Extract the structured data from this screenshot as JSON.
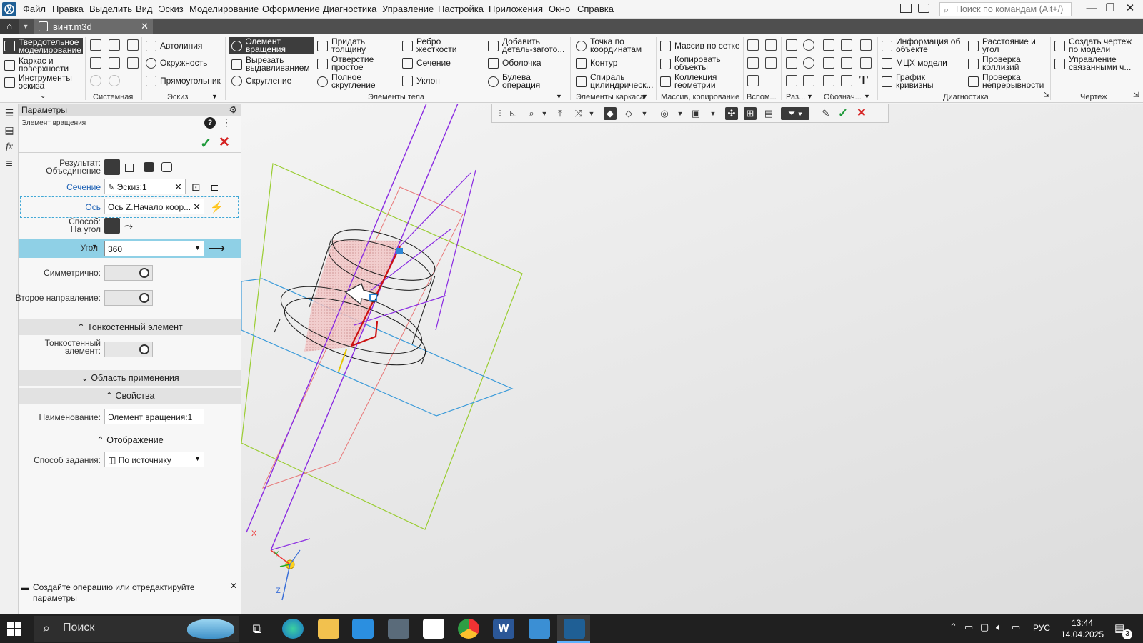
{
  "menu": [
    "Файл",
    "Правка",
    "Выделить",
    "Вид",
    "Эскиз",
    "Моделирование",
    "Оформление",
    "Диагностика",
    "Управление",
    "Настройка",
    "Приложения",
    "Окно",
    "Справка"
  ],
  "command_search_placeholder": "Поиск по командам (Alt+/)",
  "document_tab": "винт.m3d",
  "ribbon": {
    "modes": [
      "Твердотельное моделирование",
      "Каркас и поверхности",
      "Инструменты эскиза"
    ],
    "sketch": [
      "Автолиния",
      "Окружность",
      "Прямоугольник"
    ],
    "body1": [
      "Элемент вращения",
      "Вырезать выдавливанием",
      "Скругление"
    ],
    "body2": [
      "Придать толщину",
      "Отверстие простое",
      "Полное скругление"
    ],
    "body3": [
      "Ребро жесткости",
      "Сечение",
      "Уклон"
    ],
    "body4": [
      "Добавить деталь-загото...",
      "Оболочка",
      "Булева операция"
    ],
    "frame": [
      "Точка по координатам",
      "Контур",
      "Спираль цилиндрическ..."
    ],
    "array": [
      "Массив по сетке",
      "Копировать объекты",
      "Коллекция геометрии"
    ],
    "diag1": [
      "Информация об объекте",
      "МЦХ модели",
      "График кривизны"
    ],
    "diag2": [
      "Расстояние и угол",
      "Проверка коллизий",
      "Проверка непрерывности"
    ],
    "drawing": [
      "Создать чертеж по модели",
      "Управление связанными ч..."
    ],
    "groups": {
      "system": "Системная",
      "sketch": "Эскиз",
      "body": "Элементы тела",
      "frame": "Элементы каркаса",
      "array": "Массив, копирование",
      "aux": "Вспом...",
      "size": "Раз...",
      "notation": "Обознач...",
      "diag": "Диагностика",
      "drawing": "Чертеж"
    }
  },
  "panel": {
    "title": "Параметры",
    "subtitle": "Элемент вращения",
    "result_label": "Результат:",
    "result_value": "Объединение",
    "section_link": "Сечение",
    "section_value": "Эскиз:1",
    "axis_link": "Ось",
    "axis_value": "Ось Z.Начало коор...",
    "method_label": "Способ:",
    "method_value": "На угол",
    "angle_label": "Угол",
    "angle_value": "360",
    "symmetric_label": "Симметрично:",
    "second_dir_label": "Второе направление:",
    "thinwall_section": "Тонкостенный элемент",
    "thinwall_label_1": "Тонкостенный",
    "thinwall_label_2": "элемент:",
    "scope_section": "Область применения",
    "props_section": "Свойства",
    "name_label": "Наименование:",
    "name_value": "Элемент вращения:1",
    "display_section": "Отображение",
    "mode_label": "Способ задания:",
    "mode_value": "По источнику",
    "hint_line1": "Создайте операцию или отредактируйте",
    "hint_line2": "параметры"
  },
  "viewport": {
    "axis_x": "X",
    "axis_y": "Y",
    "axis_z": "Z"
  },
  "taskbar": {
    "search": "Поиск",
    "lang": "РУС",
    "time": "13:44",
    "date": "14.04.2025",
    "notif": "3"
  }
}
